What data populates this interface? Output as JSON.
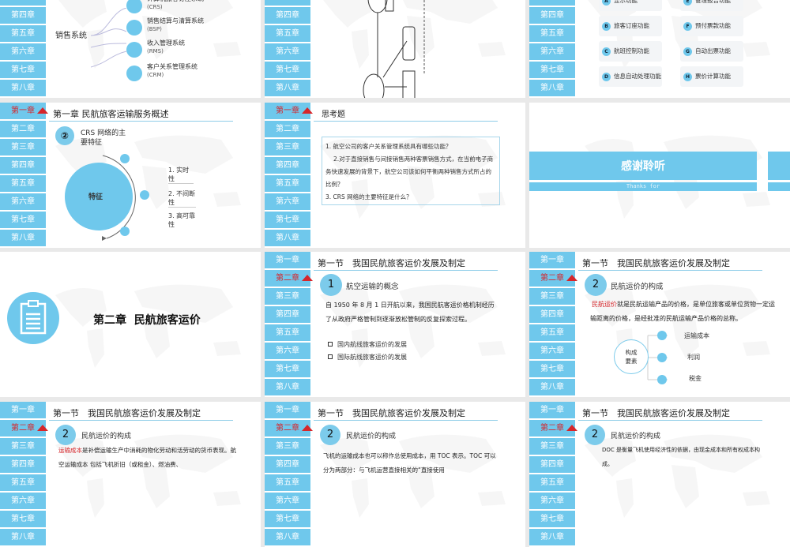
{
  "chapters": [
    "第一章",
    "第二章",
    "第三章",
    "第四章",
    "第五章",
    "第六章",
    "第七章",
    "第八章"
  ],
  "colors": {
    "accent": "#6fc8ec",
    "active_text": "#d6262b",
    "background": "#e9e9e9"
  },
  "s1": {
    "label": "销售系统",
    "items": [
      {
        "name": "计算机旅客订座系统",
        "code": "(CRS)",
        "icon": "wrench-icon"
      },
      {
        "name": "销售结算与清算系统",
        "code": "(BSP)",
        "icon": "star-icon"
      },
      {
        "name": "收入管理系统",
        "code": "(RMS)",
        "icon": "recycle-icon"
      },
      {
        "name": "客户关系管理系统",
        "code": "(CRM)",
        "icon": "paper-plane-icon"
      }
    ]
  },
  "s3": {
    "functions": [
      {
        "letter": "A",
        "label": "显示功能"
      },
      {
        "letter": "E",
        "label": "管理报告功能"
      },
      {
        "letter": "B",
        "label": "旅客订座功能"
      },
      {
        "letter": "F",
        "label": "预付票款功能"
      },
      {
        "letter": "C",
        "label": "航班控制功能"
      },
      {
        "letter": "G",
        "label": "自动出票功能"
      },
      {
        "letter": "D",
        "label": "信息自动处理功能"
      },
      {
        "letter": "H",
        "label": "票价计算功能"
      }
    ]
  },
  "s4": {
    "title": "第一章 民航旅客运输服务概述",
    "num": "②",
    "heading": "CRS 网络的主要特征",
    "center": "特征",
    "features": [
      "1. 实时性",
      "2. 不间断性",
      "3. 高可靠性"
    ]
  },
  "s5": {
    "title": "思考题",
    "q1": "1. 航空公司的客户关系管理系统具有哪些功能？",
    "q2": "2.对于直接销售与间接销售两种客票销售方式，在当前电子商务快速发展的背景下，航空公司该如何平衡两种销售方式所占的比例？",
    "q3": "3. CRS 网络的主要特征是什么？"
  },
  "s6": {
    "title": "感谢聆听",
    "subtitle": "Thanks for"
  },
  "s7": {
    "title": "第二章  民航旅客运价"
  },
  "s8": {
    "title": "第一节　我国民航旅客运价发展及制定",
    "num": "1",
    "heading": "航空运输的概念",
    "para": "自 1950 年 8 月 1 日开航以来，我国民航客运价格机制经历了从政府严格管制到逐渐放松管制的反复探索过程。",
    "bullets": [
      "国内航线旅客运价的发展",
      "国际航线旅客运价的发展"
    ]
  },
  "s9": {
    "title": "第一节　我国民航旅客运价发展及制定",
    "num": "2",
    "heading": "民航运价的构成",
    "term": "民航运价",
    "para": "就是民航运输产品的价格，是单位旅客或单位货物一定运输距离的价格，是经批准的民航运输产品价格的总称。",
    "center": "构成要素",
    "elements": [
      "运输成本",
      "利润",
      "税金"
    ]
  },
  "s10": {
    "title": "第一节　我国民航旅客运价发展及制定",
    "num": "2",
    "heading": "民航运价的构成",
    "term": "运输成本",
    "para": "是补偿运输生产中消耗的物化劳动和活劳动的货币表现。航空运输成本 包括飞机折旧（或租金）、燃油费、"
  },
  "s11": {
    "title": "第一节　我国民航旅客运价发展及制定",
    "num": "2",
    "heading": "民航运价的构成",
    "para": "飞机的运输成本也可以称作总使用成本，用 TOC 表示。TOC 可以分为两部分：与飞机运营直接相关的“直接使用"
  },
  "s12": {
    "title": "第一节　我国民航旅客运价发展及制定",
    "num": "2",
    "heading": "民航运价的构成",
    "para": "DOC 是衡量飞机使用经济性的依据，由现金成本和所有权成本构成。"
  }
}
